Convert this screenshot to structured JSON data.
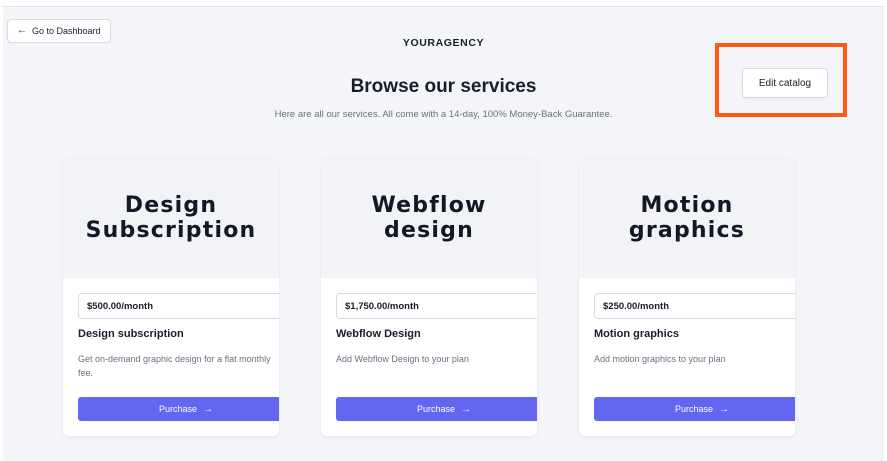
{
  "header": {
    "back_label": "Go to Dashboard",
    "brand": "YOURAGENCY",
    "title": "Browse our services",
    "subtitle": "Here are all our services. All come with a 14-day, 100% Money-Back Guarantee.",
    "edit_label": "Edit catalog"
  },
  "colors": {
    "accent": "#6366f1",
    "highlight": "#ff5a16",
    "background": "#f4f5f8"
  },
  "icons": {
    "back": "arrow-left-icon",
    "purchase": "arrow-right-icon",
    "select": "chevron-down-icon"
  },
  "cards": [
    {
      "hero": "Design\nSubscription",
      "price": "$500.00/month",
      "name": "Design subscription",
      "description": "Get on-demand graphic design for a flat monthly fee.",
      "button": "Purchase"
    },
    {
      "hero": "Webflow\ndesign",
      "price": "$1,750.00/month",
      "name": "Webflow Design",
      "description": "Add Webflow Design to your plan",
      "button": "Purchase"
    },
    {
      "hero": "Motion\ngraphics",
      "price": "$250.00/month",
      "name": "Motion graphics",
      "description": "Add motion graphics to your plan",
      "button": "Purchase"
    }
  ]
}
